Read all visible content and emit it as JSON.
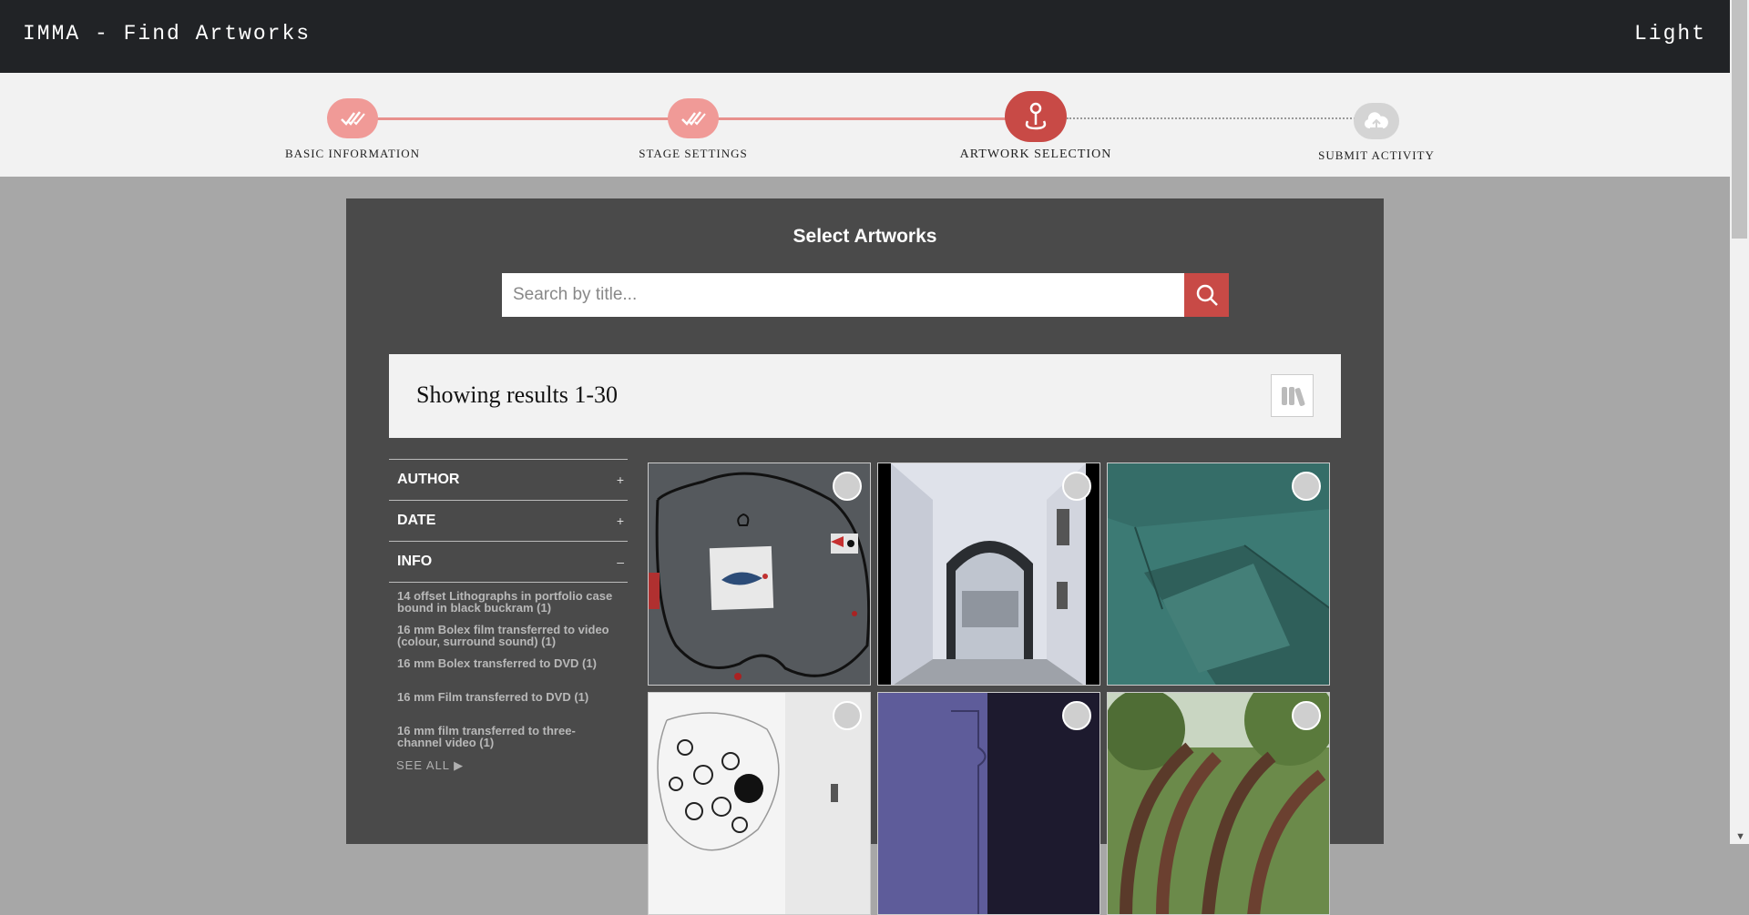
{
  "header": {
    "title": "IMMA - Find Artworks",
    "theme_toggle": "Light"
  },
  "stepper": {
    "steps": [
      {
        "label": "BASIC INFORMATION",
        "state": "done",
        "icon": "double-check-icon"
      },
      {
        "label": "STAGE SETTINGS",
        "state": "done",
        "icon": "double-check-icon"
      },
      {
        "label": "ARTWORK SELECTION",
        "state": "active",
        "icon": "map-pin-icon"
      },
      {
        "label": "SUBMIT ACTIVITY",
        "state": "todo",
        "icon": "cloud-upload-icon"
      }
    ]
  },
  "panel": {
    "title": "Select Artworks",
    "search": {
      "placeholder": "Search by title...",
      "value": "",
      "icon": "search-icon"
    },
    "results_text": "Showing results 1-30",
    "view_toggle_icon": "library-icon"
  },
  "filters": {
    "sections": [
      {
        "label": "AUTHOR",
        "toggle": "+"
      },
      {
        "label": "DATE",
        "toggle": "+"
      },
      {
        "label": "INFO",
        "toggle": "–"
      }
    ],
    "info_items": [
      "14 offset Lithographs in portfolio case bound in black buckram (1)",
      "16 mm Bolex film transferred to video (colour, surround sound) (1)",
      "16 mm Bolex transferred to DVD (1)",
      "16 mm Film transferred to DVD (1)",
      "16 mm film transferred to three-channel video (1)"
    ],
    "see_all": "SEE ALL ▶"
  },
  "colors": {
    "accent": "#c84a46",
    "done": "#f09a97",
    "topbar": "#212326",
    "panel": "#4a4a4a"
  }
}
